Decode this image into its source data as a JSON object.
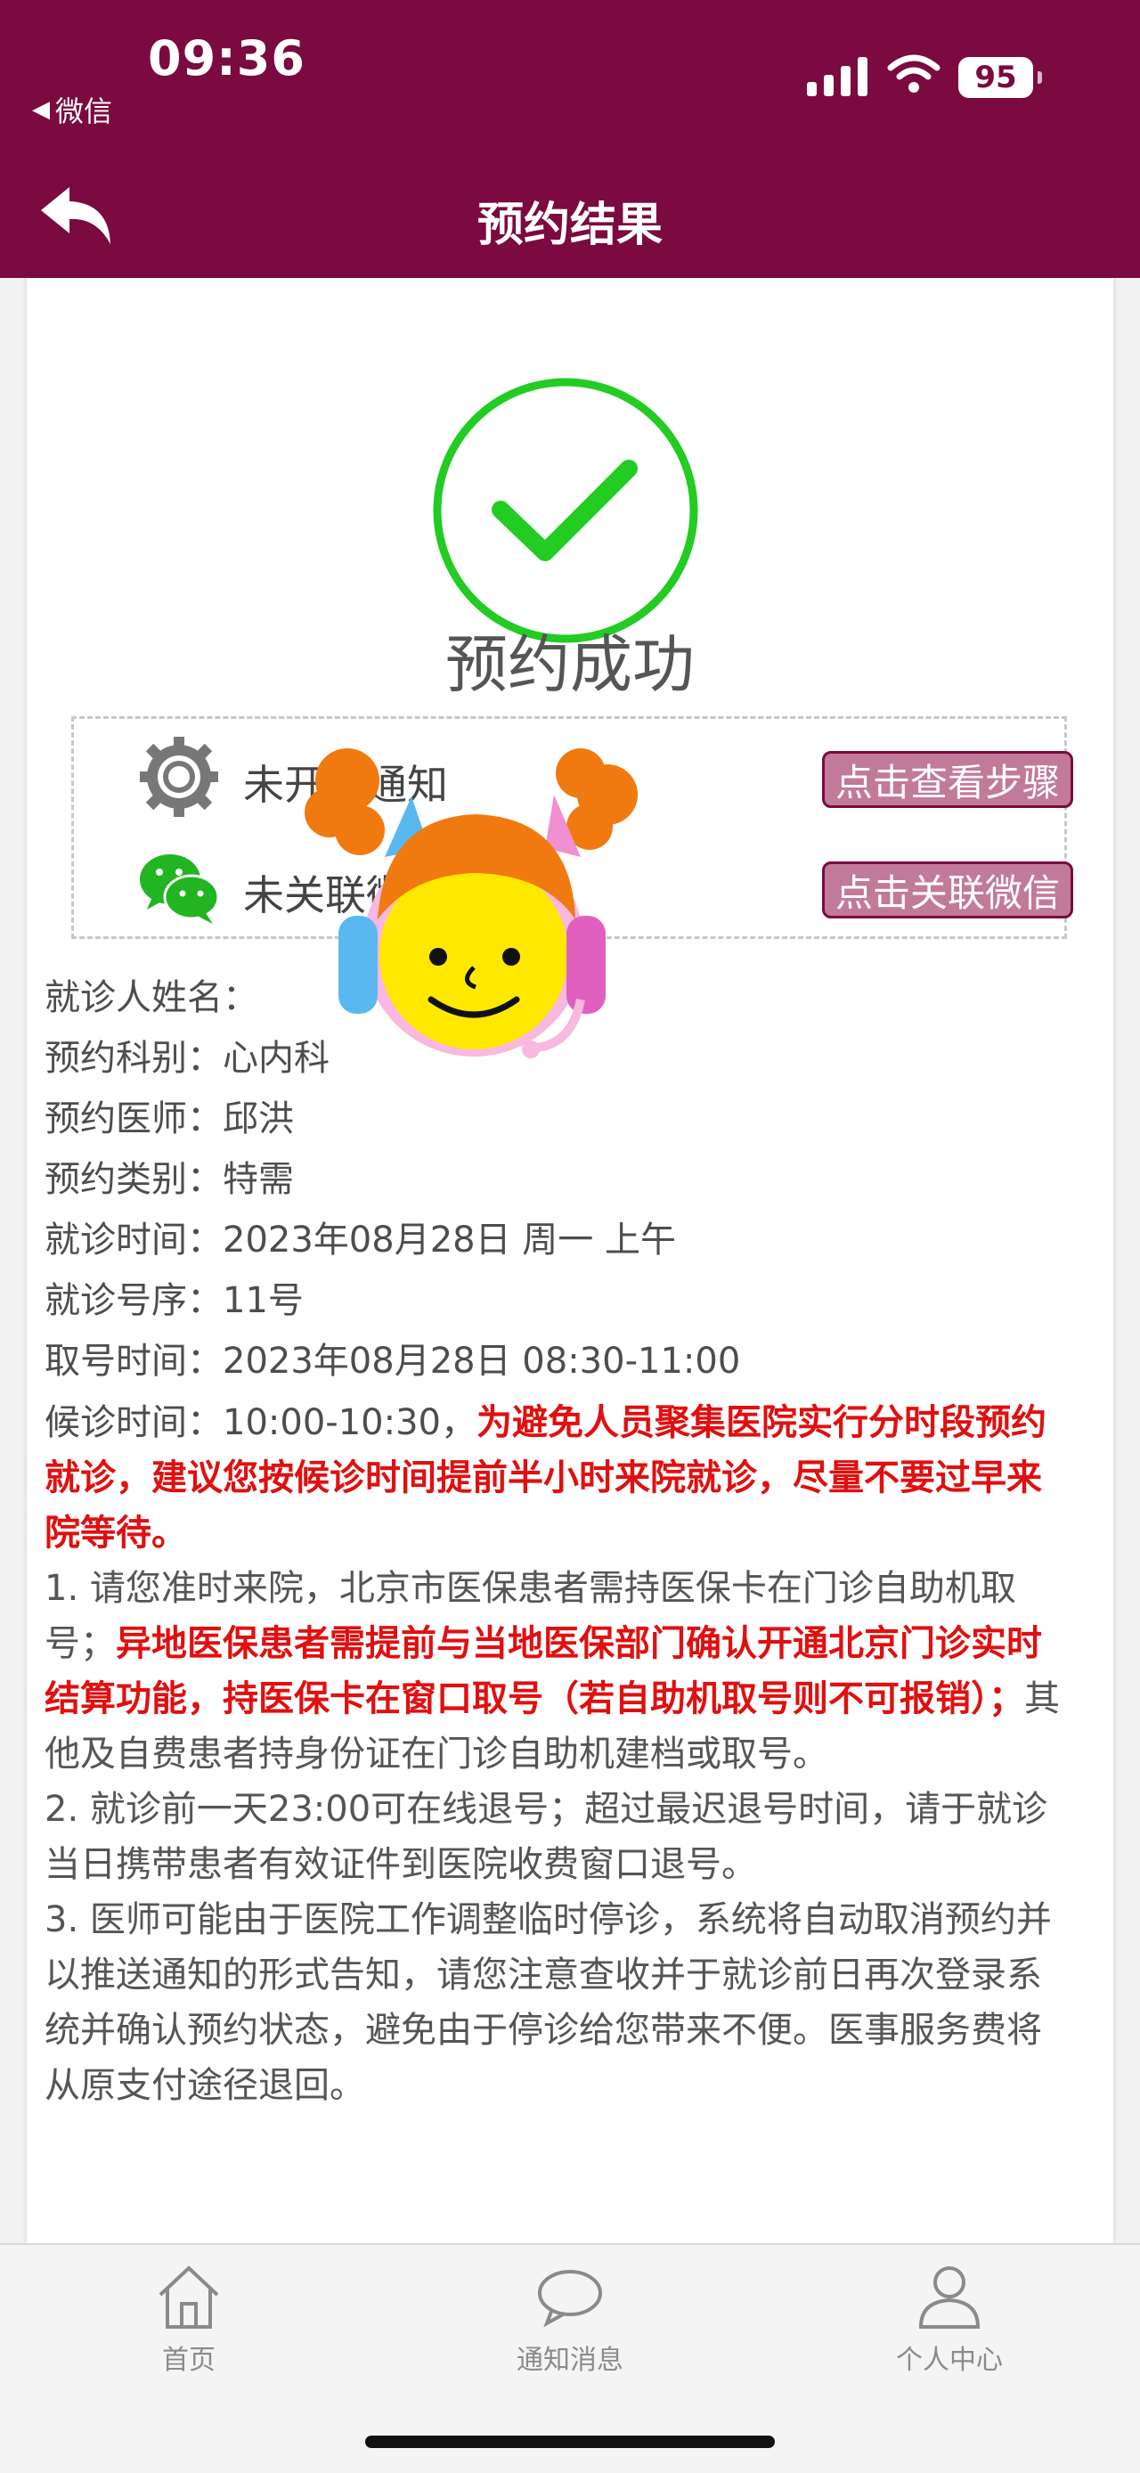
{
  "status_bar": {
    "time": "09:36",
    "back_app": "微信",
    "battery": "95"
  },
  "header": {
    "title": "预约结果"
  },
  "result": {
    "title": "预约成功"
  },
  "notifications": [
    {
      "label": "未开启通知",
      "button": "点击查看步骤",
      "icon": "gear-icon"
    },
    {
      "label": "未关联微信",
      "button": "点击关联微信",
      "icon": "wechat-icon"
    }
  ],
  "info": [
    {
      "label": "就诊人姓名：",
      "value": ""
    },
    {
      "label": "预约科别：",
      "value": "心内科"
    },
    {
      "label": "预约医师：",
      "value": "邱洪"
    },
    {
      "label": "预约类别：",
      "value": "特需"
    },
    {
      "label": "就诊时间：",
      "value": "2023年08月28日 周一 上午"
    },
    {
      "label": "就诊号序：",
      "value": "11号"
    },
    {
      "label": "取号时间：",
      "value": "2023年08月28日 08:30-11:00"
    }
  ],
  "wait": {
    "label": "候诊时间：",
    "value": "10:00-10:30，",
    "warning": "为避免人员聚集医院实行分时段预约就诊，建议您按候诊时间提前半小时来院就诊，尽量不要过早来院等待。"
  },
  "notes": {
    "n1_a": "1. 请您准时来院，北京市医保患者需持医保卡在门诊自助机取号；",
    "n1_red": "异地医保患者需提前与当地医保部门确认开通北京门诊实时结算功能，持医保卡在窗口取号（若自助机取号则不可报销）；",
    "n1_b": "其他及自费患者持身份证在门诊自助机建档或取号。",
    "n2": "2. 就诊前一天23:00可在线退号；超过最迟退号时间，请于就诊当日携带患者有效证件到医院收费窗口退号。",
    "n3": "3. 医师可能由于医院工作调整临时停诊，系统将自动取消预约并以推送通知的形式告知，请您注意查收并于就诊前日再次登录系统并确认预约状态，避免由于停诊给您带来不便。医事服务费将从原支付途径退回。"
  },
  "tabs": [
    {
      "label": "首页",
      "icon": "home-icon"
    },
    {
      "label": "通知消息",
      "icon": "message-icon"
    },
    {
      "label": "个人中心",
      "icon": "user-icon"
    }
  ],
  "colors": {
    "brand": "#7a0a3f",
    "success": "#22cc22",
    "warning": "#e01010",
    "button_bg": "#c27a99"
  }
}
